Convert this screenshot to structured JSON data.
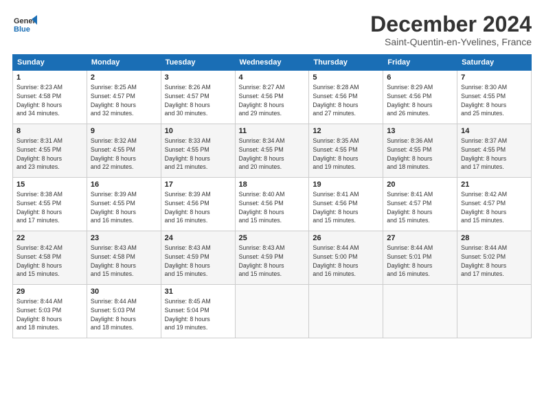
{
  "logo": {
    "line1": "General",
    "line2": "Blue"
  },
  "title": "December 2024",
  "location": "Saint-Quentin-en-Yvelines, France",
  "headers": [
    "Sunday",
    "Monday",
    "Tuesday",
    "Wednesday",
    "Thursday",
    "Friday",
    "Saturday"
  ],
  "weeks": [
    [
      {
        "day": "1",
        "info": "Sunrise: 8:23 AM\nSunset: 4:58 PM\nDaylight: 8 hours\nand 34 minutes."
      },
      {
        "day": "2",
        "info": "Sunrise: 8:25 AM\nSunset: 4:57 PM\nDaylight: 8 hours\nand 32 minutes."
      },
      {
        "day": "3",
        "info": "Sunrise: 8:26 AM\nSunset: 4:57 PM\nDaylight: 8 hours\nand 30 minutes."
      },
      {
        "day": "4",
        "info": "Sunrise: 8:27 AM\nSunset: 4:56 PM\nDaylight: 8 hours\nand 29 minutes."
      },
      {
        "day": "5",
        "info": "Sunrise: 8:28 AM\nSunset: 4:56 PM\nDaylight: 8 hours\nand 27 minutes."
      },
      {
        "day": "6",
        "info": "Sunrise: 8:29 AM\nSunset: 4:56 PM\nDaylight: 8 hours\nand 26 minutes."
      },
      {
        "day": "7",
        "info": "Sunrise: 8:30 AM\nSunset: 4:55 PM\nDaylight: 8 hours\nand 25 minutes."
      }
    ],
    [
      {
        "day": "8",
        "info": "Sunrise: 8:31 AM\nSunset: 4:55 PM\nDaylight: 8 hours\nand 23 minutes."
      },
      {
        "day": "9",
        "info": "Sunrise: 8:32 AM\nSunset: 4:55 PM\nDaylight: 8 hours\nand 22 minutes."
      },
      {
        "day": "10",
        "info": "Sunrise: 8:33 AM\nSunset: 4:55 PM\nDaylight: 8 hours\nand 21 minutes."
      },
      {
        "day": "11",
        "info": "Sunrise: 8:34 AM\nSunset: 4:55 PM\nDaylight: 8 hours\nand 20 minutes."
      },
      {
        "day": "12",
        "info": "Sunrise: 8:35 AM\nSunset: 4:55 PM\nDaylight: 8 hours\nand 19 minutes."
      },
      {
        "day": "13",
        "info": "Sunrise: 8:36 AM\nSunset: 4:55 PM\nDaylight: 8 hours\nand 18 minutes."
      },
      {
        "day": "14",
        "info": "Sunrise: 8:37 AM\nSunset: 4:55 PM\nDaylight: 8 hours\nand 17 minutes."
      }
    ],
    [
      {
        "day": "15",
        "info": "Sunrise: 8:38 AM\nSunset: 4:55 PM\nDaylight: 8 hours\nand 17 minutes."
      },
      {
        "day": "16",
        "info": "Sunrise: 8:39 AM\nSunset: 4:55 PM\nDaylight: 8 hours\nand 16 minutes."
      },
      {
        "day": "17",
        "info": "Sunrise: 8:39 AM\nSunset: 4:56 PM\nDaylight: 8 hours\nand 16 minutes."
      },
      {
        "day": "18",
        "info": "Sunrise: 8:40 AM\nSunset: 4:56 PM\nDaylight: 8 hours\nand 15 minutes."
      },
      {
        "day": "19",
        "info": "Sunrise: 8:41 AM\nSunset: 4:56 PM\nDaylight: 8 hours\nand 15 minutes."
      },
      {
        "day": "20",
        "info": "Sunrise: 8:41 AM\nSunset: 4:57 PM\nDaylight: 8 hours\nand 15 minutes."
      },
      {
        "day": "21",
        "info": "Sunrise: 8:42 AM\nSunset: 4:57 PM\nDaylight: 8 hours\nand 15 minutes."
      }
    ],
    [
      {
        "day": "22",
        "info": "Sunrise: 8:42 AM\nSunset: 4:58 PM\nDaylight: 8 hours\nand 15 minutes."
      },
      {
        "day": "23",
        "info": "Sunrise: 8:43 AM\nSunset: 4:58 PM\nDaylight: 8 hours\nand 15 minutes."
      },
      {
        "day": "24",
        "info": "Sunrise: 8:43 AM\nSunset: 4:59 PM\nDaylight: 8 hours\nand 15 minutes."
      },
      {
        "day": "25",
        "info": "Sunrise: 8:43 AM\nSunset: 4:59 PM\nDaylight: 8 hours\nand 15 minutes."
      },
      {
        "day": "26",
        "info": "Sunrise: 8:44 AM\nSunset: 5:00 PM\nDaylight: 8 hours\nand 16 minutes."
      },
      {
        "day": "27",
        "info": "Sunrise: 8:44 AM\nSunset: 5:01 PM\nDaylight: 8 hours\nand 16 minutes."
      },
      {
        "day": "28",
        "info": "Sunrise: 8:44 AM\nSunset: 5:02 PM\nDaylight: 8 hours\nand 17 minutes."
      }
    ],
    [
      {
        "day": "29",
        "info": "Sunrise: 8:44 AM\nSunset: 5:03 PM\nDaylight: 8 hours\nand 18 minutes."
      },
      {
        "day": "30",
        "info": "Sunrise: 8:44 AM\nSunset: 5:03 PM\nDaylight: 8 hours\nand 18 minutes."
      },
      {
        "day": "31",
        "info": "Sunrise: 8:45 AM\nSunset: 5:04 PM\nDaylight: 8 hours\nand 19 minutes."
      },
      {
        "day": "",
        "info": ""
      },
      {
        "day": "",
        "info": ""
      },
      {
        "day": "",
        "info": ""
      },
      {
        "day": "",
        "info": ""
      }
    ]
  ]
}
